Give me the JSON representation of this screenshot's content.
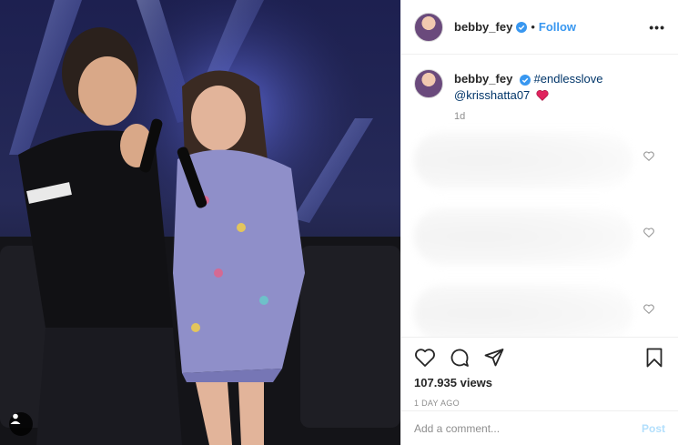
{
  "post": {
    "username": "bebby_fey",
    "separator": "•",
    "follow_label": "Follow",
    "more_label": "•••",
    "caption_hashtag": "#endlesslove",
    "caption_mention": "@krisshatta07",
    "caption_time": "1d",
    "views": "107.935 views",
    "date": "1 DAY AGO"
  },
  "comment_box": {
    "placeholder": "Add a comment...",
    "post_label": "Post"
  },
  "colors": {
    "link": "#3897f0",
    "hashtag": "#003569",
    "heart": "#ed4956"
  },
  "icons": [
    "user-tag-icon",
    "verified-badge-icon",
    "more-options-icon",
    "heart-emoji-icon",
    "like-icon",
    "comment-icon",
    "share-icon",
    "save-icon"
  ]
}
